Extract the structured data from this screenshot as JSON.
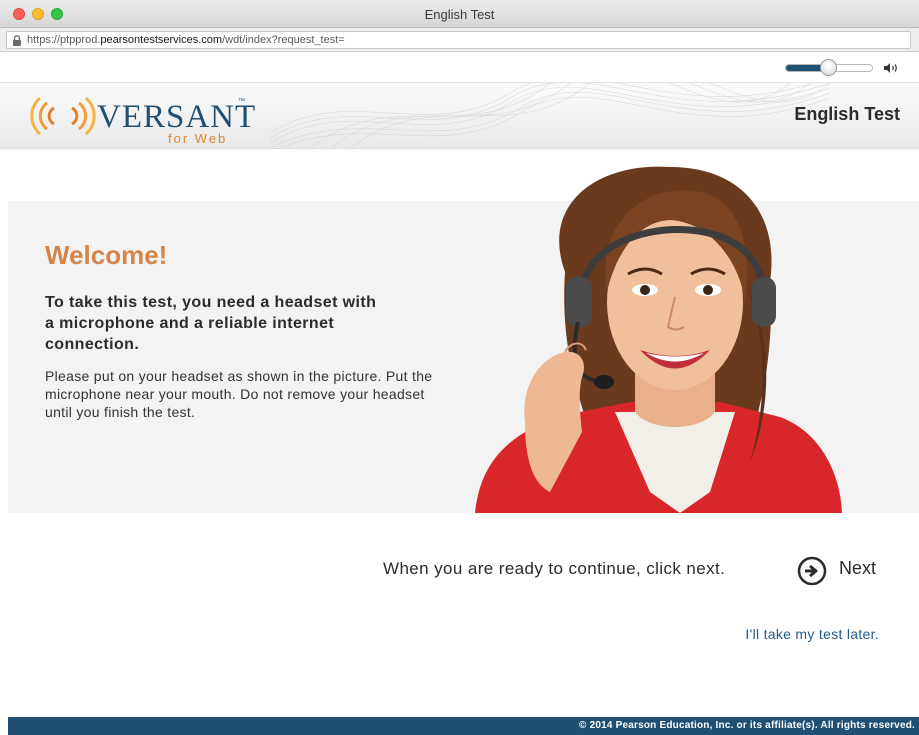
{
  "window": {
    "title": "English Test",
    "url_prefix": "https://ptpprod.",
    "url_domain": "pearsontestservices.com",
    "url_path": "/wdt/index?request_test="
  },
  "volume": {
    "level": 0.45
  },
  "header": {
    "logo_text": "VERSANT",
    "logo_tm": "™",
    "logo_sub": "for Web",
    "title": "English Test"
  },
  "content": {
    "welcome": "Welcome!",
    "lead": "To take this test, you need a headset with a microphone and a reliable internet connection.",
    "instructions": "Please put on your headset as shown in the picture. Put the microphone near your mouth. Do not remove your headset until you finish the test."
  },
  "actions": {
    "ready_text": "When you are ready to continue, click next.",
    "next_label": "Next",
    "later_link": "I'll take my test later."
  },
  "footer": {
    "copyright": "© 2014 Pearson Education, Inc. or its affiliate(s). All rights reserved."
  },
  "colors": {
    "brand_blue": "#1f4f73",
    "accent_orange": "#d3854a",
    "link_blue": "#1f5f8a"
  },
  "icons": {
    "lock": "lock-icon",
    "speaker": "speaker-icon",
    "next": "arrow-right-circle-icon",
    "logo": "radio-waves-logo"
  }
}
